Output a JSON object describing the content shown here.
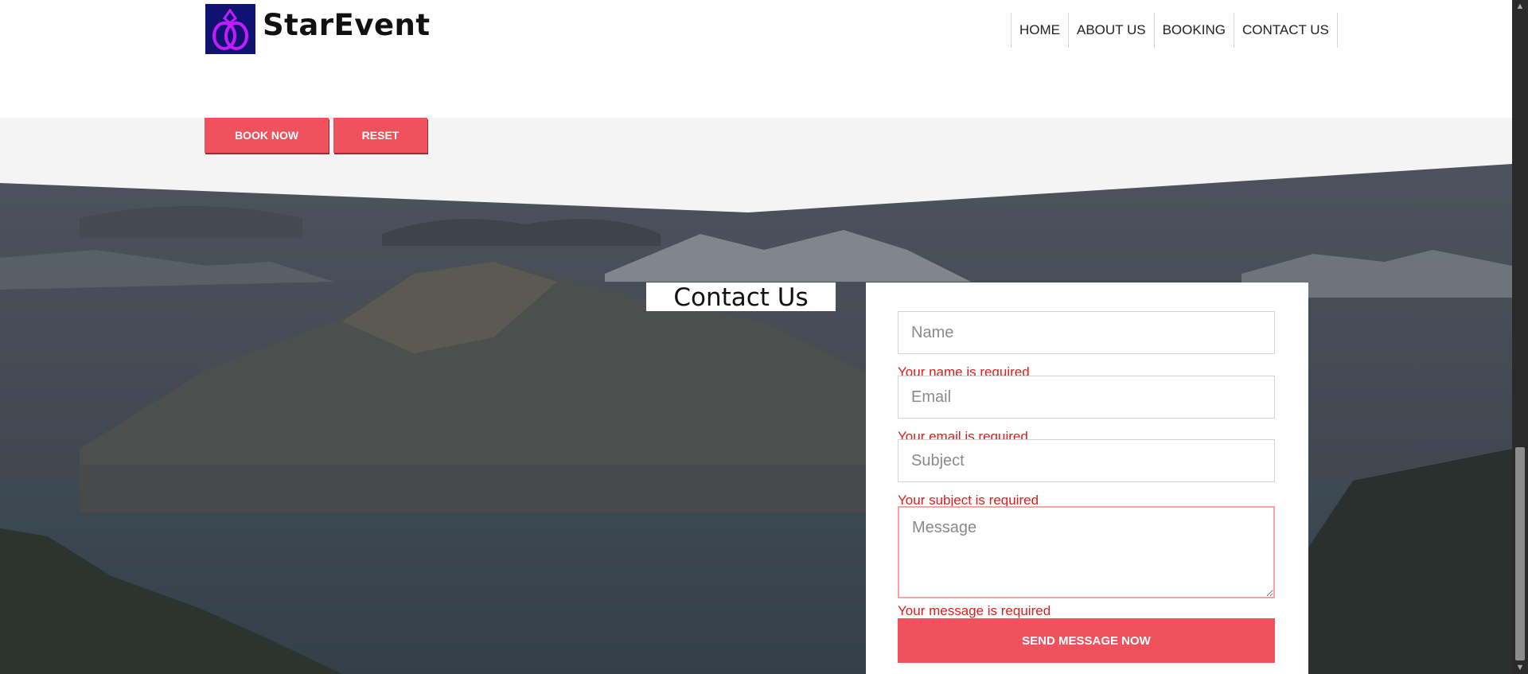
{
  "header": {
    "brand": "StarEvent",
    "logo_icon": "rings-icon",
    "nav": [
      {
        "label": "HOME"
      },
      {
        "label": "ABOUT US"
      },
      {
        "label": "BOOKING"
      },
      {
        "label": "CONTACT US"
      }
    ]
  },
  "booking": {
    "book_label": "BOOK NOW",
    "reset_label": "RESET"
  },
  "contact": {
    "title": "Contact Us",
    "name_placeholder": "Name",
    "name_error": "Your name is required",
    "email_placeholder": "Email",
    "email_error": "Your email is required",
    "subject_placeholder": "Subject",
    "subject_error": "Your subject is required",
    "message_placeholder": "Message",
    "message_error": "Your message is required",
    "send_label": "SEND MESSAGE NOW"
  },
  "colors": {
    "accent": "#ef525d",
    "error": "#e01b1b",
    "logo_bg": "#0f1270",
    "logo_ring": "#c21bff"
  }
}
